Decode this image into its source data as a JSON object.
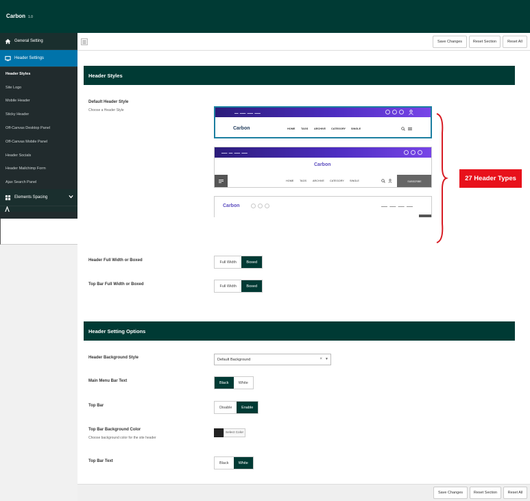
{
  "app": {
    "title": "Carbon",
    "version": "1.0"
  },
  "sidebar": {
    "sections": [
      {
        "label": "General Setting",
        "icon": "home-icon"
      },
      {
        "label": "Header Settings",
        "icon": "monitor-icon",
        "active": true
      },
      {
        "label": "Elements Spacing",
        "icon": "grid-icon"
      }
    ],
    "subitems": [
      "Header Styles",
      "Site Logo",
      "Mobile Header",
      "Sticky Header",
      "Off-Canvas Desktop Panel",
      "Off-Canvas Mobile Panel",
      "Header Socials",
      "Header Mailchimp Form",
      "Ajax Search Panel"
    ],
    "current_subitem": "Header Styles"
  },
  "actions": {
    "save": "Save Changes",
    "reset_section": "Reset Section",
    "reset_all": "Reset All"
  },
  "header_styles": {
    "title": "Header Styles",
    "default_header": {
      "label": "Default Header Style",
      "desc": "Choose a Header Style"
    },
    "callout": "27 Header Types",
    "thumb1": {
      "logo": "Carbon",
      "nav": [
        "HOME",
        "TAGS",
        "ARCHIVE",
        "CATEGORY",
        "SINGLE"
      ]
    },
    "thumb2": {
      "logo": "Carbon",
      "nav": [
        "HOME",
        "TAGS",
        "ARCHIVE",
        "CATEGORY",
        "SINGLE"
      ],
      "subscribe": "SUBSCRIBE"
    },
    "thumb3": {
      "logo": "Carbon"
    },
    "full_width": {
      "label": "Header Full Width or Boxed",
      "options": [
        "Full Width",
        "Boxed"
      ],
      "selected": "Boxed"
    },
    "topbar_width": {
      "label": "Top Bar Full Width or Boxed",
      "options": [
        "Full Width",
        "Boxed"
      ],
      "selected": "Boxed"
    }
  },
  "header_options": {
    "title": "Header Setting Options",
    "bg_style": {
      "label": "Header Background Style",
      "value": "Default Background"
    },
    "menu_text": {
      "label": "Main Menu Bar Text",
      "options": [
        "Black",
        "White"
      ],
      "selected": "Black"
    },
    "top_bar": {
      "label": "Top Bar",
      "options": [
        "Disable",
        "Enable"
      ],
      "selected": "Enable"
    },
    "top_bar_bg": {
      "label": "Top Bar Background Color",
      "desc": "Choose background color for the site header",
      "button": "Select Color",
      "color": "#222222"
    },
    "top_bar_text": {
      "label": "Top Bar Text",
      "options": [
        "Black",
        "White"
      ],
      "selected": "White"
    }
  },
  "colors": {
    "primary": "#003a34",
    "sidebar": "#212b2d",
    "active": "#0073aa",
    "callout": "#e8111b",
    "brace": "#d71a22"
  }
}
